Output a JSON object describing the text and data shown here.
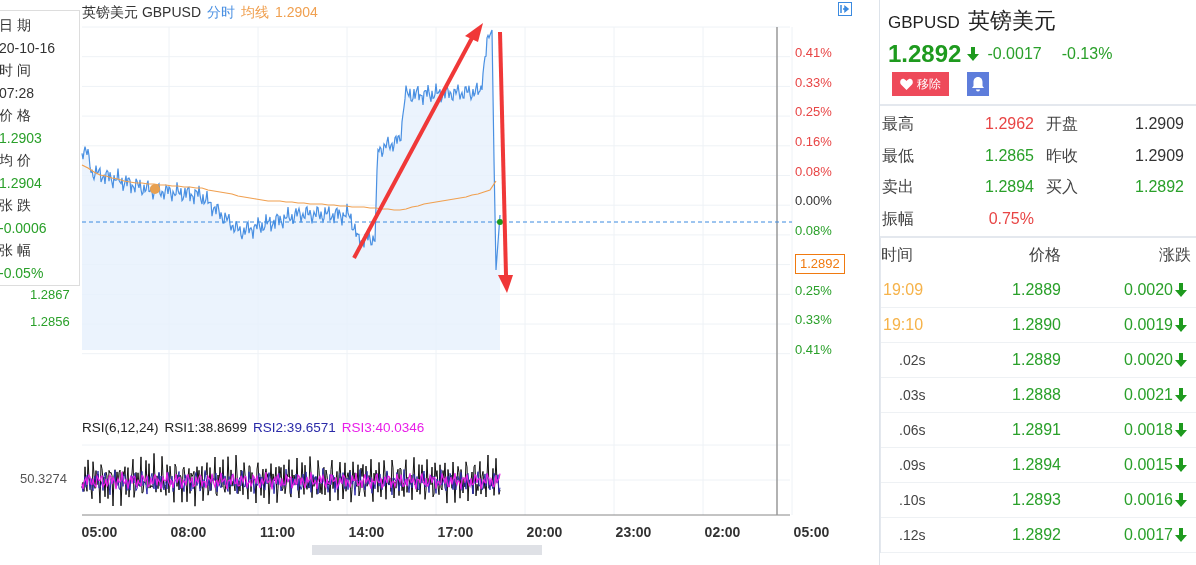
{
  "chart_header": {
    "name": "英镑美元 GBPUSD",
    "mode": "分时",
    "avg_label": "均线",
    "avg_value": "1.2904"
  },
  "tooltip": [
    {
      "label": "日 期",
      "value": "20-10-16",
      "kind": "neutral"
    },
    {
      "label": "时 间",
      "value": "07:28",
      "kind": "neutral"
    },
    {
      "label": "价 格",
      "value": "1.2903",
      "kind": "loss"
    },
    {
      "label": "均 价",
      "value": "1.2904",
      "kind": "loss"
    },
    {
      "label": "张 跌",
      "value": "-0.0006",
      "kind": "loss"
    },
    {
      "label": "张 幅",
      "value": "-0.05%",
      "kind": "loss"
    }
  ],
  "price_axis": [
    "1.2867",
    "1.2856"
  ],
  "percent_axis": [
    {
      "text": "0.41%",
      "kind": "gain"
    },
    {
      "text": "0.33%",
      "kind": "gain"
    },
    {
      "text": "0.25%",
      "kind": "gain"
    },
    {
      "text": "0.16%",
      "kind": "gain"
    },
    {
      "text": "0.08%",
      "kind": "gain"
    },
    {
      "text": "0.00%",
      "kind": "neutral"
    },
    {
      "text": "0.08%",
      "kind": "loss"
    },
    {
      "text": "1.2892",
      "kind": "current"
    },
    {
      "text": "0.25%",
      "kind": "loss"
    },
    {
      "text": "0.33%",
      "kind": "loss"
    },
    {
      "text": "0.41%",
      "kind": "loss"
    }
  ],
  "rsi": {
    "title": "RSI(6,12,24)",
    "rsi1": "RSI1:38.8699",
    "rsi2": "RSI2:39.6571",
    "rsi3": "RSI3:40.0346",
    "axis_value": "50.3274"
  },
  "time_axis": [
    "05:00",
    "08:00",
    "11:00",
    "14:00",
    "17:00",
    "20:00",
    "23:00",
    "02:00",
    "05:00"
  ],
  "quote": {
    "symbol": "GBPUSD",
    "name": "英镑美元",
    "price": "1.2892",
    "falling": true,
    "change": "-0.0017",
    "change_pct": "-0.13%",
    "remove_label": "移除"
  },
  "stats": [
    {
      "label": "最高",
      "value": "1.2962",
      "kind": "gain"
    },
    {
      "label": "开盘",
      "value": "1.2909",
      "kind": "neutral"
    },
    {
      "label": "最低",
      "value": "1.2865",
      "kind": "loss"
    },
    {
      "label": "昨收",
      "value": "1.2909",
      "kind": "neutral"
    },
    {
      "label": "卖出",
      "value": "1.2894",
      "kind": "loss"
    },
    {
      "label": "买入",
      "value": "1.2892",
      "kind": "loss"
    },
    {
      "label": "振幅",
      "value": "0.75%",
      "kind": "gain"
    }
  ],
  "ticks": {
    "columns": [
      "时间",
      "价格",
      "涨跌"
    ],
    "rows": [
      {
        "time": "19:09",
        "kind": "minute",
        "price": "1.2889",
        "change": "0.0020",
        "falling": true
      },
      {
        "time": "19:10",
        "kind": "minute",
        "price": "1.2890",
        "change": "0.0019",
        "falling": true
      },
      {
        "time": ".02s",
        "kind": "second",
        "price": "1.2889",
        "change": "0.0020",
        "falling": true
      },
      {
        "time": ".03s",
        "kind": "second",
        "price": "1.2888",
        "change": "0.0021",
        "falling": true
      },
      {
        "time": ".06s",
        "kind": "second",
        "price": "1.2891",
        "change": "0.0018",
        "falling": true
      },
      {
        "time": ".09s",
        "kind": "second",
        "price": "1.2894",
        "change": "0.0015",
        "falling": true
      },
      {
        "time": ".10s",
        "kind": "second",
        "price": "1.2893",
        "change": "0.0016",
        "falling": true
      },
      {
        "time": ".12s",
        "kind": "second",
        "price": "1.2892",
        "change": "0.0017",
        "falling": true
      }
    ]
  }
}
